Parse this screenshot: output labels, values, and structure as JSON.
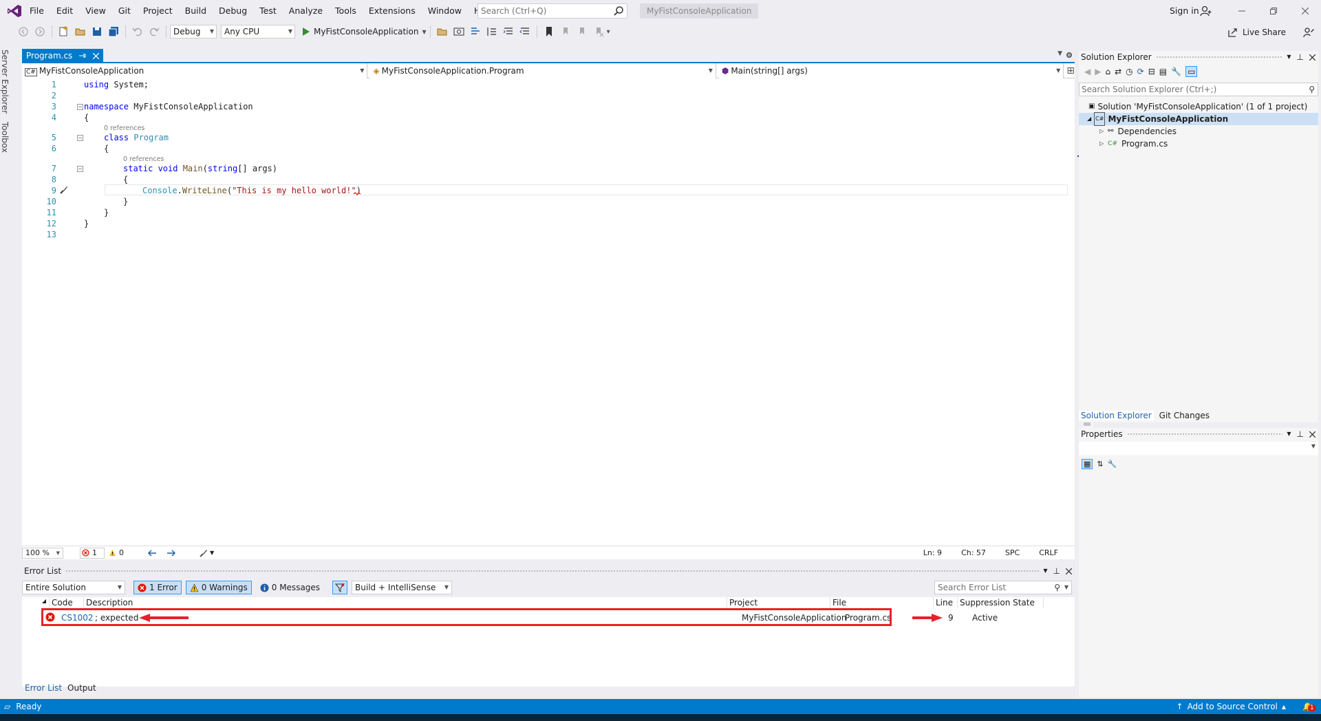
{
  "window": {
    "menu": [
      "File",
      "Edit",
      "View",
      "Git",
      "Project",
      "Build",
      "Debug",
      "Test",
      "Analyze",
      "Tools",
      "Extensions",
      "Window",
      "Help"
    ],
    "search_placeholder": "Search (Ctrl+Q)",
    "solution_name": "MyFistConsoleApplication",
    "sign_in": "Sign in"
  },
  "toolbar": {
    "configuration": "Debug",
    "platform": "Any CPU",
    "start_target": "MyFistConsoleApplication",
    "live_share": "Live Share"
  },
  "side_tabs": [
    "Server Explorer",
    "Toolbox"
  ],
  "editor": {
    "tab_label": "Program.cs",
    "nav_project": "MyFistConsoleApplication",
    "nav_class": "MyFistConsoleApplication.Program",
    "nav_member": "Main(string[] args)",
    "references_label": "0 references",
    "line_numbers": [
      "1",
      "2",
      "3",
      "4",
      "5",
      "6",
      "7",
      "8",
      "9",
      "10",
      "11",
      "12",
      "13"
    ],
    "code": {
      "l1_kw": "using",
      "l1_rest": " System;",
      "l3_kw": "namespace",
      "l3_rest": " MyFistConsoleApplication",
      "l4": "{",
      "l5_kw": "class",
      "l5_cls": " Program",
      "l6": "{",
      "l7_kw": "static void",
      "l7_mth": " Main",
      "l7_p1": "(",
      "l7_kw2": "string",
      "l7_p2": "[] args)",
      "l8": "{",
      "l9_cls": "Console",
      "l9_dot": ".",
      "l9_mth": "WriteLine",
      "l9_p1": "(",
      "l9_str": "\"This is my hello world!\"",
      "l9_p2": ")",
      "l10": "}",
      "l11": "}",
      "l12": "}"
    },
    "zoom": "100 %",
    "error_count": "1",
    "warning_count": "0",
    "status": {
      "line": "Ln: 9",
      "col": "Ch: 57",
      "spc": "SPC",
      "eol": "CRLF"
    }
  },
  "error_list": {
    "title": "Error List",
    "scope": "Entire Solution",
    "errors_btn": "1 Error",
    "warnings_btn": "0 Warnings",
    "messages_btn": "0 Messages",
    "source": "Build + IntelliSense",
    "search_placeholder": "Search Error List",
    "columns": {
      "code": "Code",
      "description": "Description",
      "project": "Project",
      "file": "File",
      "line": "Line",
      "suppression": "Suppression State"
    },
    "rows": [
      {
        "code": "CS1002",
        "description": "; expected",
        "project": "MyFistConsoleApplication",
        "file": "Program.cs",
        "line": "9",
        "suppression": "Active"
      }
    ],
    "bottom_tabs": [
      "Error List",
      "Output"
    ]
  },
  "solution_explorer": {
    "title": "Solution Explorer",
    "search_placeholder": "Search Solution Explorer (Ctrl+;)",
    "solution_label": "Solution 'MyFistConsoleApplication' (1 of 1 project)",
    "project": "MyFistConsoleApplication",
    "items": [
      "Dependencies",
      "Program.cs"
    ],
    "bottom_tabs": [
      "Solution Explorer",
      "Git Changes"
    ]
  },
  "properties": {
    "title": "Properties"
  },
  "statusbar": {
    "ready": "Ready",
    "source_control": "Add to Source Control",
    "notification_count": "1"
  },
  "colors": {
    "accent": "#007acc",
    "error": "#e51400",
    "highlight_box": "#e8202a",
    "arrow": "#e8202a"
  }
}
